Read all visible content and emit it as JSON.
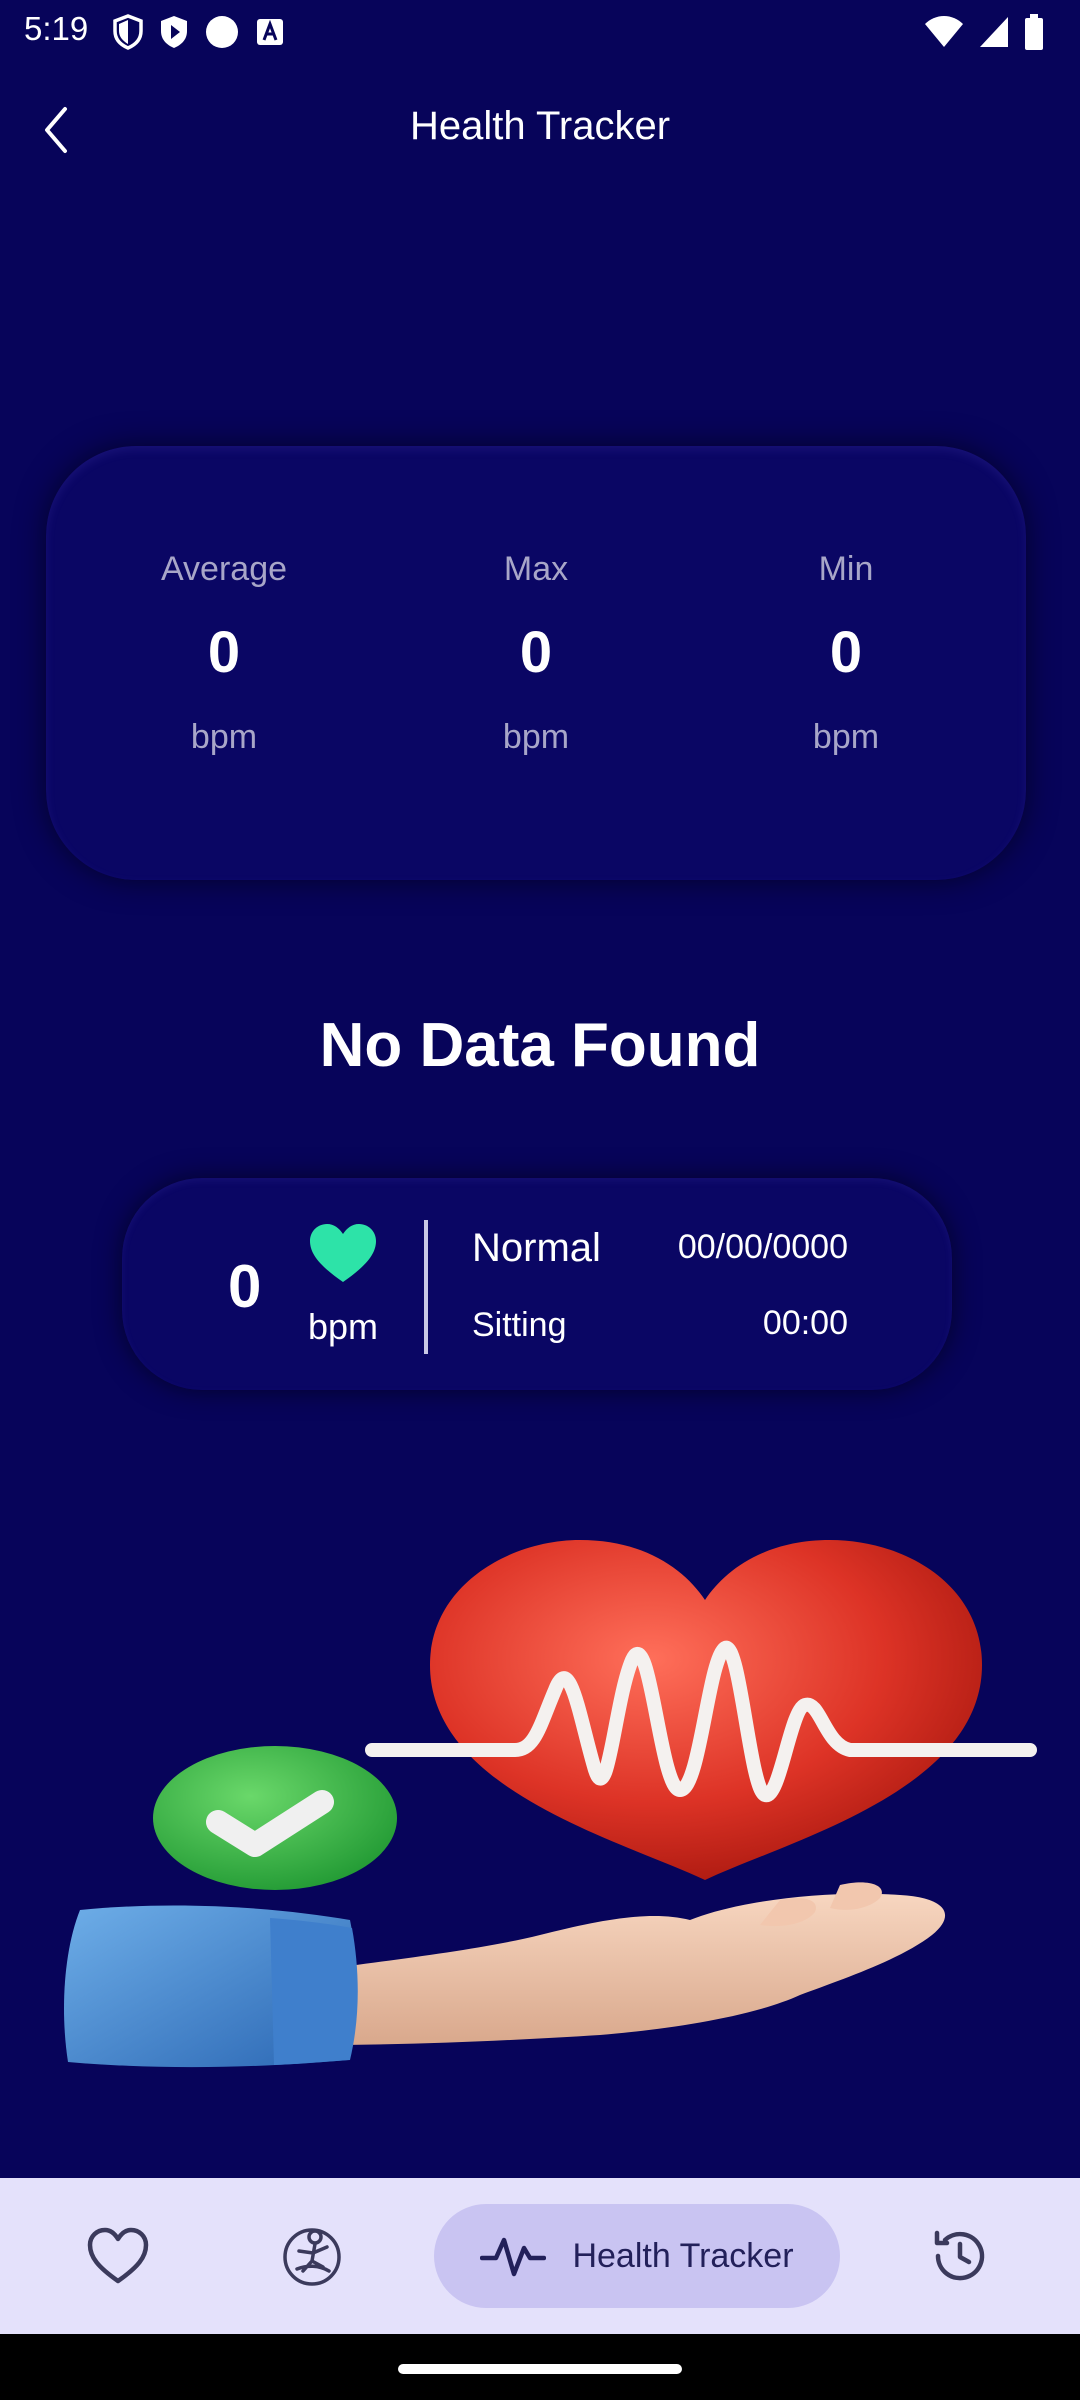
{
  "status_bar": {
    "time": "5:19",
    "icons_left": [
      "shield-icon",
      "play-protect-icon",
      "circle-icon",
      "text-icon"
    ],
    "icons_right": [
      "wifi-icon",
      "signal-icon",
      "battery-icon"
    ]
  },
  "header": {
    "title": "Health Tracker"
  },
  "stats": [
    {
      "label": "Average",
      "value": "0",
      "unit": "bpm"
    },
    {
      "label": "Max",
      "value": "0",
      "unit": "bpm"
    },
    {
      "label": "Min",
      "value": "0",
      "unit": "bpm"
    }
  ],
  "empty_state": {
    "message": "No Data Found"
  },
  "reading": {
    "value": "0",
    "unit": "bpm",
    "status": "Normal",
    "posture": "Sitting",
    "date": "00/00/0000",
    "time": "00:00"
  },
  "bottom_nav": {
    "items": [
      {
        "icon": "heart-outline-icon"
      },
      {
        "icon": "meditation-icon"
      },
      {
        "icon": "pulse-icon",
        "label": "Health Tracker",
        "active": true
      },
      {
        "icon": "history-icon"
      }
    ]
  },
  "colors": {
    "background": "#07045a",
    "card": "#0a0664",
    "accent_heart": "#2de3a8",
    "nav_background": "#e4e1fb",
    "nav_active": "#c9c4f2"
  }
}
